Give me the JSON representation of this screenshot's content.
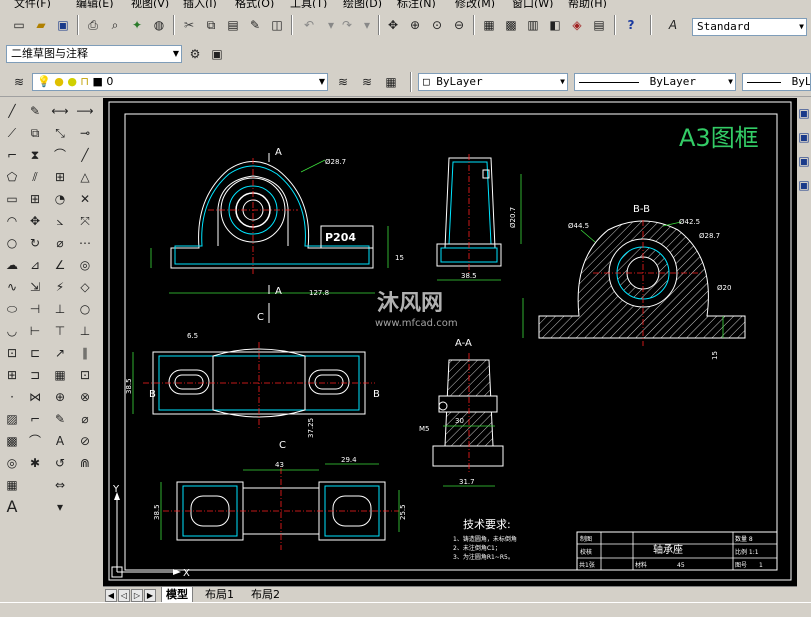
{
  "menu": [
    "文件(F)",
    "编辑(E)",
    "视图(V)",
    "插入(I)",
    "格式(O)",
    "工具(T)",
    "绘图(D)",
    "标注(N)",
    "修改(M)",
    "窗口(W)",
    "帮助(H)"
  ],
  "text_style": "Standard",
  "workspace": "二维草图与注释",
  "layer": {
    "name": "0"
  },
  "props": {
    "color": "ByLayer",
    "linetype": "ByLayer",
    "lineweight": "ByLay"
  },
  "drawing": {
    "frame_title": "A3图框",
    "watermark_name": "沐风网",
    "watermark_url": "www.mfcad.com",
    "label_A_top": "A",
    "label_A_bottom": "A",
    "label_C_mid": "C",
    "label_C": "C",
    "label_B_left": "B",
    "label_B_right": "B",
    "section_BB": "B-B",
    "section_AA": "A-A",
    "part_label": "P204",
    "dims": {
      "d_28_7a": "Ø28.7",
      "d_127_8": "127.8",
      "d_38_5a": "38.5",
      "d_20_7": "Ø20.7",
      "d_15a": "15",
      "d_44_5": "Ø44.5",
      "d_42_5": "Ø42.5",
      "d_28_7b": "Ø28.7",
      "d_20": "Ø20",
      "d_15b": "15",
      "d_38_5b": "38.5",
      "d_37_25": "37.25",
      "d_43": "43",
      "d_29_4": "29.4",
      "d_38_5c": "38.5",
      "d_25_5": "25.5",
      "d_30": "30",
      "d_31_7": "31.7",
      "d_M5": "M5",
      "d_6_5": "6.5"
    },
    "tech_title": "技术要求:",
    "tech_notes": [
      "1、铸造圆角，未标倒角",
      "2、未注倒角C1；",
      "3、为注圆角R1~R5。"
    ],
    "title_block": {
      "drawn": "制图",
      "checked": "校核",
      "name": "轴承座",
      "qty": "共1张",
      "material": "材料",
      "mat_value": "45",
      "weight": "数量 8",
      "scale": "比例 1:1",
      "sheet": "图号",
      "sheet_no": "1"
    },
    "ucs_x": "X",
    "ucs_y": "Y"
  },
  "tabs": [
    "模型",
    "布局1",
    "布局2"
  ],
  "colors": {
    "canvas": "#000000",
    "line_white": "#ffffff",
    "line_cyan": "#00e5ff",
    "line_green": "#3cdc3c",
    "line_red": "#ff2020",
    "line_yellow": "#ffff3c",
    "title_green": "#33cc66"
  }
}
